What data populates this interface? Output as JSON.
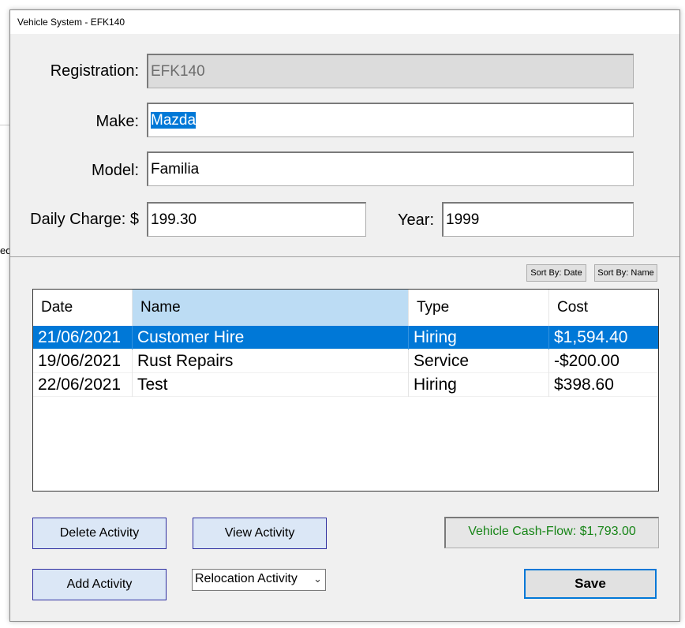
{
  "window": {
    "title": "Vehicle System - EFK140"
  },
  "background": {
    "stub_text": "ed"
  },
  "form": {
    "registration_label": "Registration:",
    "registration_value": "EFK140",
    "make_label": "Make:",
    "make_value": "Mazda",
    "model_label": "Model:",
    "model_value": "Familia",
    "daily_charge_label": "Daily Charge: $",
    "daily_charge_value": "199.30",
    "year_label": "Year:",
    "year_value": "1999"
  },
  "sort": {
    "by_date": "Sort By: Date",
    "by_name": "Sort By: Name"
  },
  "activities": {
    "columns": [
      "Date",
      "Name",
      "Type",
      "Cost"
    ],
    "rows": [
      {
        "date": "21/06/2021",
        "name": "Customer Hire",
        "type": "Hiring",
        "cost": "$1,594.40",
        "selected": true
      },
      {
        "date": "19/06/2021",
        "name": "Rust Repairs",
        "type": "Service",
        "cost": "-$200.00",
        "selected": false
      },
      {
        "date": "22/06/2021",
        "name": "Test",
        "type": "Hiring",
        "cost": "$398.60",
        "selected": false
      }
    ]
  },
  "actions": {
    "delete": "Delete Activity",
    "view": "View Activity",
    "add": "Add Activity",
    "activity_type_selected": "Relocation Activity",
    "cashflow": "Vehicle Cash-Flow: $1,793.00",
    "save": "Save"
  },
  "colors": {
    "selection": "#0078d7",
    "cashflow_text": "#178517",
    "button_border": "#2e2ea0"
  }
}
